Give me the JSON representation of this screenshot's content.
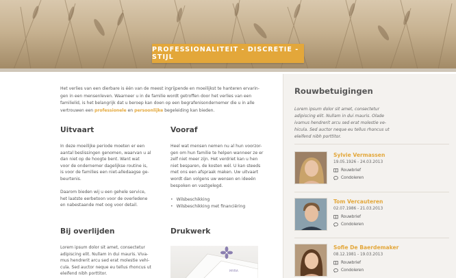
{
  "hero": {
    "tagline": "PROFESSIONALITEIT - DISCRETIE - STIJL"
  },
  "intro": {
    "line1": "Het verlies van een dierbare is één van de meest ingrijpende en moeilijkst te hanteren ervarin-",
    "line2": "gen in een mensenleven. Waarneer u in de familie wordt getroffen door het verlies van een",
    "line3": "familielid, is het belangrijk dat u beroep kan doen op een begrafenisondernemer die u in alle",
    "line4_pre": "vertrouwen een ",
    "hl1": "professionele",
    "line4_mid": " en ",
    "hl2": "persoonlijke",
    "line4_post": " begeleiding kan bieden."
  },
  "uitvaart": {
    "title": "Uitvaart",
    "lines": [
      "In deze moeilijke periode moeten er een",
      "aantal beslissingen genomen, waarvan u al",
      "dan niet op de hoogte bent. Want wat",
      "voor de ondernemer dagelijkse routine is,",
      "is voor de families een niet-alledaagse ge-",
      "beurtenis.",
      "",
      "Daarom bieden wij u een gehele service,",
      "het laatste eerbetoon voor de overledene",
      "en nabestaande met oog voor detail."
    ]
  },
  "vooraf": {
    "title": "Vooraf",
    "lines": [
      "Heel wat mensen nemen nu al hun voorzor-",
      "gen om hun familie te helpen wanneer ze er",
      "zelf niet meer zijn. Het verdriet kan u hen",
      "niet besparen, de kosten wél. U kan steeds",
      "met ons een afspraak maken. Uw uitvaart",
      "wordt dan volgens uw wensen en ideeën",
      "bespoken en vastgelegd."
    ],
    "bullets": [
      "Wilsbeschikking",
      "Wilsbeschikking met financiëring"
    ]
  },
  "overlijden": {
    "title": "Bij overlijden",
    "lines": [
      "Lorem ipsum dolor sit amet, consectetur",
      "adipiscing elit. Nullam in dui mauris. Viva-",
      "mus hendrerit arcu sed erat molestie vehi-",
      "cula. Sed auctor neque eu tellus rhoncus ut",
      "eleifend nibh porttitor."
    ]
  },
  "drukwerk": {
    "title": "Drukwerk",
    "card_text": "MYRA"
  },
  "sidebar": {
    "title": "Rouwbetuigingen",
    "intro_lines": [
      "Lorem ipsum dolor sit amet, consectetur",
      "adipiscing elit. Nullam in dui mauris. Olade",
      "ivamus hendrerit arcu sed erat molestie ve-",
      "hicula. Sed auctor neque eu tellus rhoncus ut",
      "eleifend nibh porttitor."
    ],
    "people": [
      {
        "name": "Sylvie Vermassen",
        "dates": "19.05.1926 - 24.03.2013",
        "link1": "Rouwbrief",
        "link2": "Condoleren"
      },
      {
        "name": "Tom Vercauteren",
        "dates": "02.07.1986 - 21.03.2013",
        "link1": "Rouwbrief",
        "link2": "Condoleren"
      },
      {
        "name": "Sofie De Baerdemaker",
        "dates": "08.12.1981 - 19.03.2013",
        "link1": "Rouwbrief",
        "link2": "Condoleren"
      }
    ]
  },
  "colors": {
    "accent": "#e3a73a",
    "sidebar_bg": "#f4f2ef",
    "heading": "#444444"
  }
}
